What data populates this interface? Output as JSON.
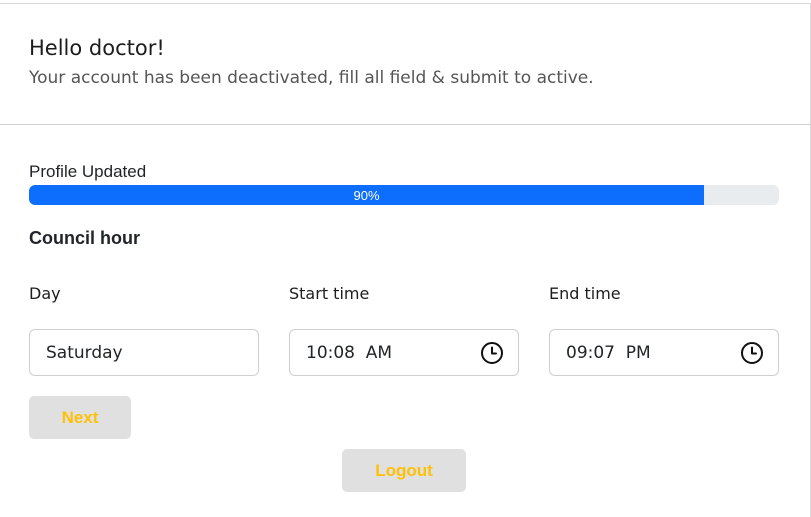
{
  "header": {
    "greeting": "Hello doctor!",
    "subtitle": "Your account has been deactivated, fill all field & submit to active."
  },
  "progress": {
    "label": "Profile Updated",
    "value_text": "90%",
    "percent": 90,
    "fill_color": "#0d6efd"
  },
  "section": {
    "title": "Council hour"
  },
  "fields": {
    "day": {
      "label": "Day",
      "value": "Saturday"
    },
    "start_time": {
      "label": "Start time",
      "value": "10:08  AM",
      "icon": "clock-icon"
    },
    "end_time": {
      "label": "End time",
      "value": "09:07  PM",
      "icon": "clock-icon"
    }
  },
  "buttons": {
    "next_label": "Next",
    "logout_label": "Logout",
    "text_color": "#ffc107",
    "bg_color": "#e0e0e0"
  }
}
